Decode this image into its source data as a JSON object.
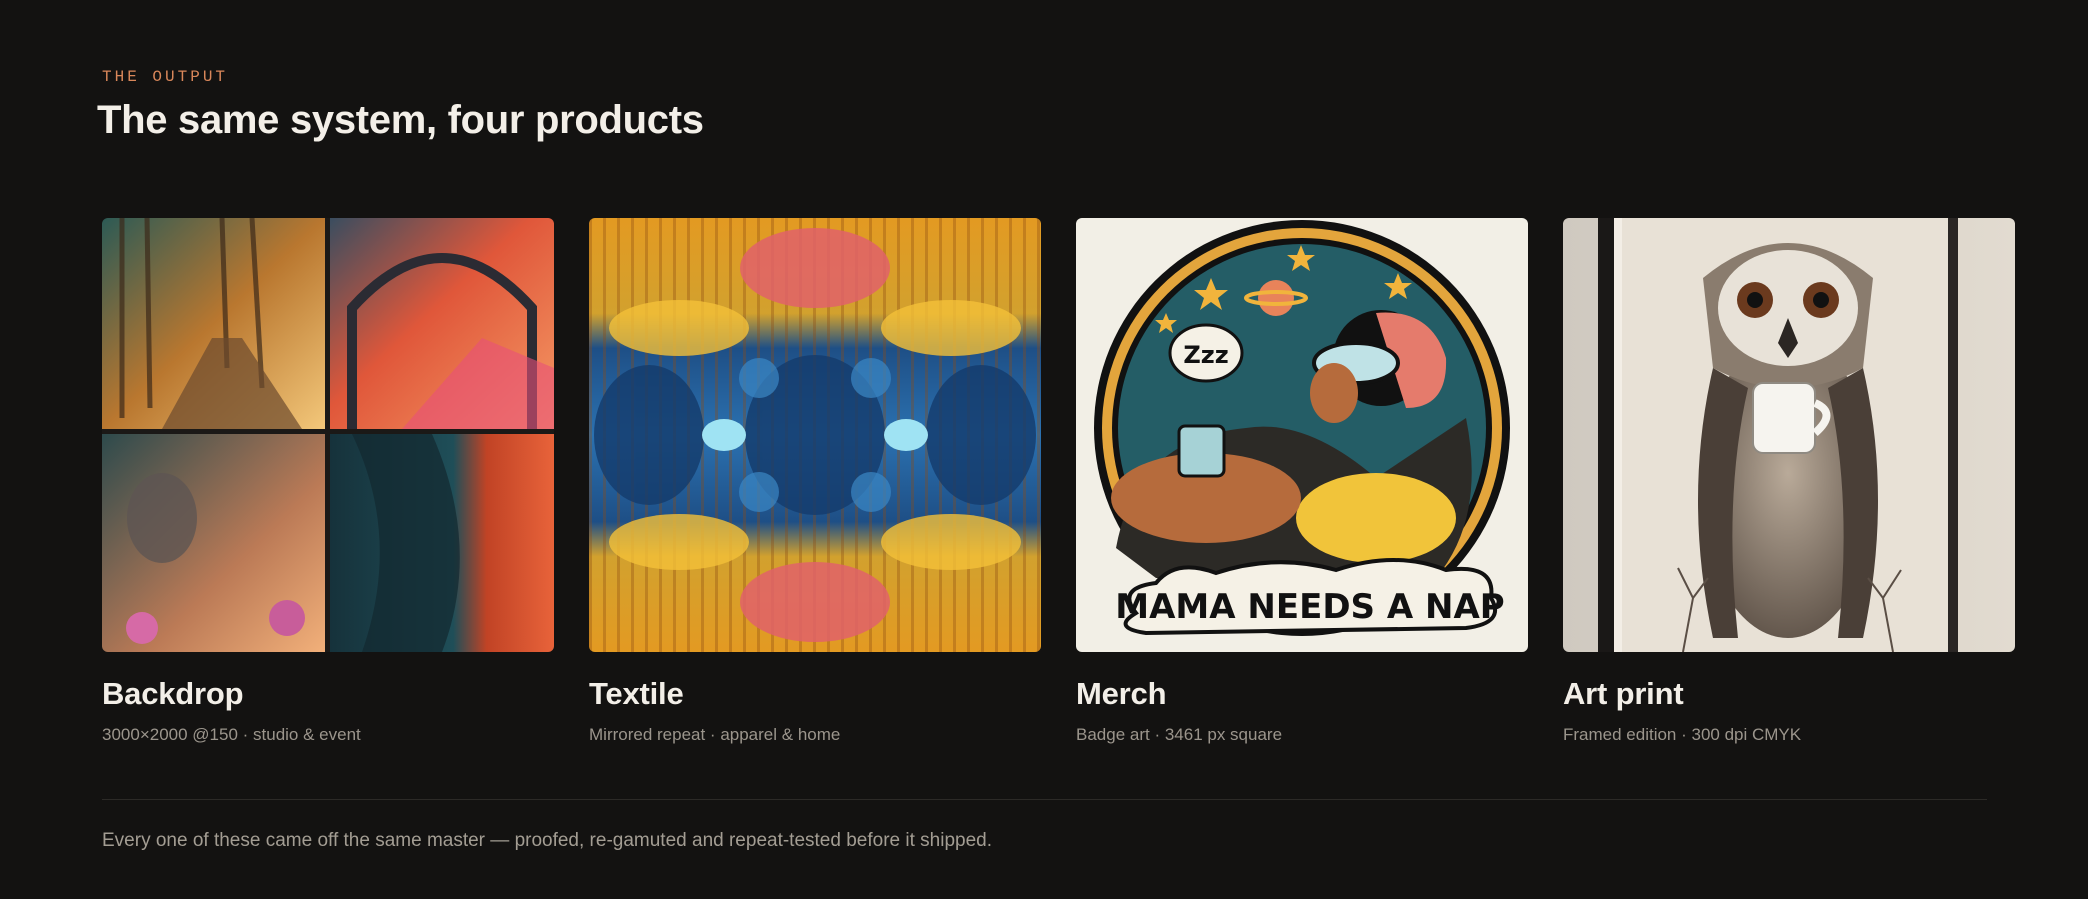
{
  "section": {
    "eyebrow": "THE OUTPUT",
    "title": "The same system, four products"
  },
  "cards": [
    {
      "title": "Backdrop",
      "meta": "3000×2000 @150 · studio & event",
      "image": "photo-collage-four-panels"
    },
    {
      "title": "Textile",
      "meta": "Mirrored repeat · apparel & home",
      "image": "mirrored-floral-pattern"
    },
    {
      "title": "Merch",
      "meta": "Badge art · 3461 px square",
      "image": "badge-illustration",
      "badge_text": "MAMA NEEDS A NAP",
      "bubble_text": "Zzz"
    },
    {
      "title": "Art print",
      "meta": "Framed edition · 300 dpi CMYK",
      "image": "owl-framed-print"
    }
  ],
  "footer": {
    "note": "Every one of these came off the same master — proofed, re-gamuted and repeat-tested before it shipped."
  },
  "colors": {
    "background": "#131211",
    "accent": "#d9875a",
    "text": "#f3efe8",
    "muted": "#9b958c"
  }
}
